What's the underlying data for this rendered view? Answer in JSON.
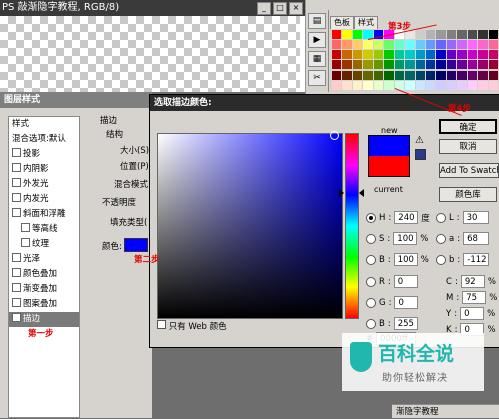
{
  "document_window": {
    "title": "PS 敲渐隐字教程, RGB/8)",
    "buttons": [
      "_",
      "□",
      "×"
    ]
  },
  "swatches_panel": {
    "tabs": [
      "色板",
      "样式"
    ],
    "tools": [
      "tool-a",
      "tool-b",
      "tool-c",
      "tool-d"
    ],
    "swatch_colors": [
      "#ff0000",
      "#ffff00",
      "#00ff00",
      "#00ffff",
      "#0000ff",
      "#ff00ff",
      "#ffffff",
      "#e6e6e6",
      "#cccccc",
      "#b3b3b3",
      "#999999",
      "#808080",
      "#666666",
      "#4d4d4d",
      "#333333",
      "#000000",
      "#ff6666",
      "#ff9966",
      "#ffcc66",
      "#ffff66",
      "#ccff66",
      "#66ff66",
      "#66ffcc",
      "#66ffff",
      "#66ccff",
      "#6699ff",
      "#6666ff",
      "#9966ff",
      "#cc66ff",
      "#ff66ff",
      "#ff66cc",
      "#ff6699",
      "#cc0000",
      "#cc6600",
      "#cc9900",
      "#cccc00",
      "#99cc00",
      "#00cc00",
      "#00cc99",
      "#00cccc",
      "#0099cc",
      "#0066cc",
      "#0000cc",
      "#6600cc",
      "#9900cc",
      "#cc00cc",
      "#cc0099",
      "#cc0066",
      "#990000",
      "#993300",
      "#996600",
      "#999900",
      "#669900",
      "#009900",
      "#009966",
      "#009999",
      "#006699",
      "#003399",
      "#000099",
      "#330099",
      "#660099",
      "#990099",
      "#990066",
      "#990033",
      "#660000",
      "#662200",
      "#664400",
      "#666600",
      "#446600",
      "#006600",
      "#006644",
      "#006666",
      "#004466",
      "#002266",
      "#000066",
      "#220066",
      "#440066",
      "#660066",
      "#660044",
      "#660022",
      "#ffcccc",
      "#ffe0cc",
      "#fff0cc",
      "#ffffcc",
      "#e6ffcc",
      "#ccffcc",
      "#ccffe6",
      "#ccffff",
      "#cce6ff",
      "#ccd9ff",
      "#ccccff",
      "#d9ccff",
      "#e6ccff",
      "#ffccff",
      "#ffcce6",
      "#ffccd9"
    ]
  },
  "layer_style": {
    "title": "图层样式",
    "list": [
      {
        "label": "样式",
        "checkbox": false,
        "head": true
      },
      {
        "label": "混合选项:默认",
        "checkbox": false,
        "head": true
      },
      {
        "label": "投影",
        "checkbox": true
      },
      {
        "label": "内阴影",
        "checkbox": true
      },
      {
        "label": "外发光",
        "checkbox": true
      },
      {
        "label": "内发光",
        "checkbox": true
      },
      {
        "label": "斜面和浮雕",
        "checkbox": true
      },
      {
        "label": "等高线",
        "checkbox": true,
        "indent": true
      },
      {
        "label": "纹理",
        "checkbox": true,
        "indent": true
      },
      {
        "label": "光泽",
        "checkbox": true
      },
      {
        "label": "颜色叠加",
        "checkbox": true
      },
      {
        "label": "渐变叠加",
        "checkbox": true
      },
      {
        "label": "图案叠加",
        "checkbox": true
      },
      {
        "label": "描边",
        "checkbox": true,
        "selected": true
      }
    ],
    "section_title": "描边",
    "structure_label": "结构",
    "size_label": "大小(S)",
    "position_label": "位置(P)",
    "blend_label": "混合模式",
    "opacity_label": "不透明度",
    "fill_type_label": "填充类型(",
    "color_label": "颜色:",
    "color_value": "#0000ff"
  },
  "color_picker": {
    "title": "选取描边颜色:",
    "new_label": "new",
    "current_label": "current",
    "new_color": "#0000ff",
    "current_color": "#ff0000",
    "web_only_label": "只有 Web 颜色",
    "buttons": {
      "ok": "确定",
      "cancel": "取消",
      "add_swatch": "Add To Swatch",
      "color_library": "颜色库"
    },
    "hsb": [
      {
        "key": "H",
        "value": "240",
        "unit": "度",
        "selected": true
      },
      {
        "key": "S",
        "value": "100",
        "unit": "%",
        "selected": false
      },
      {
        "key": "B",
        "value": "100",
        "unit": "%",
        "selected": false
      }
    ],
    "rgb": [
      {
        "key": "R",
        "value": "0"
      },
      {
        "key": "G",
        "value": "0"
      },
      {
        "key": "B",
        "value": "255"
      }
    ],
    "lab": [
      {
        "key": "L",
        "value": "30"
      },
      {
        "key": "a",
        "value": "68"
      },
      {
        "key": "b",
        "value": "-112"
      }
    ],
    "cmyk": [
      {
        "key": "C",
        "value": "92",
        "unit": "%"
      },
      {
        "key": "M",
        "value": "75",
        "unit": "%"
      },
      {
        "key": "Y",
        "value": "0",
        "unit": "%"
      },
      {
        "key": "K",
        "value": "0",
        "unit": "%"
      }
    ],
    "hex_prefix": "#",
    "hex_value": "0000ff"
  },
  "annotations": {
    "step1": "第一步",
    "step2": "第二步",
    "step3": "第3步",
    "step4": "第4步"
  },
  "watermark": {
    "title": "百科全说",
    "subtitle": "助你轻松解决"
  },
  "bottom_tab": "渐隐字教程"
}
